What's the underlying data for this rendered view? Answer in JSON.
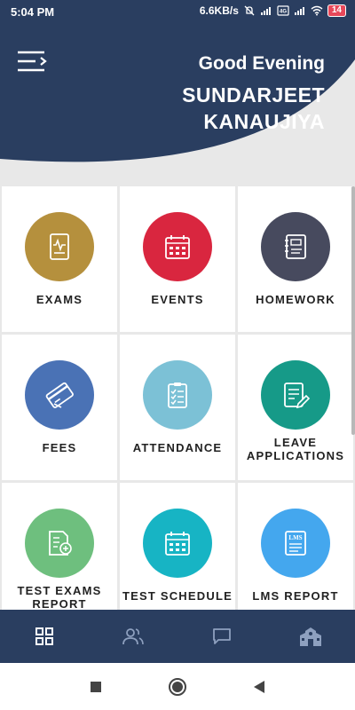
{
  "status_bar": {
    "time": "5:04 PM",
    "network_speed": "6.6KB/s",
    "battery": "14",
    "icons": [
      "mute-icon",
      "signal-icon",
      "volte-icon",
      "signal-icon",
      "wifi-icon",
      "battery-icon"
    ]
  },
  "header": {
    "greeting": "Good Evening",
    "user_name": "SUNDARJEET KANAUJIYA",
    "menu_icon": "menu-icon",
    "background_color": "#2a3e60"
  },
  "tiles": [
    {
      "label": "EXAMS",
      "icon": "exam-report-icon",
      "color": "#b5903d"
    },
    {
      "label": "EVENTS",
      "icon": "calendar-icon",
      "color": "#d9263f"
    },
    {
      "label": "HOMEWORK",
      "icon": "notebook-icon",
      "color": "#474a5e"
    },
    {
      "label": "FEES",
      "icon": "card-icon",
      "color": "#4a72b5"
    },
    {
      "label": "ATTENDANCE",
      "icon": "checklist-icon",
      "color": "#7cc1d6"
    },
    {
      "label": "LEAVE APPLICATIONS",
      "icon": "edit-document-icon",
      "color": "#169a88"
    },
    {
      "label": "TEST EXAMS REPORT",
      "icon": "test-report-icon",
      "color": "#6ebf7e"
    },
    {
      "label": "TEST SCHEDULE",
      "icon": "calendar-icon",
      "color": "#17b4c4"
    },
    {
      "label": "LMS REPORT",
      "icon": "lms-report-icon",
      "color": "#44a7ee"
    }
  ],
  "bottom_nav": [
    {
      "name": "dashboard",
      "icon": "grid-icon",
      "active": true
    },
    {
      "name": "people",
      "icon": "people-icon",
      "active": false
    },
    {
      "name": "chat",
      "icon": "chat-icon",
      "active": false
    },
    {
      "name": "school",
      "icon": "school-icon",
      "active": false
    }
  ],
  "system_nav": [
    "recents-icon",
    "home-icon",
    "back-icon"
  ]
}
